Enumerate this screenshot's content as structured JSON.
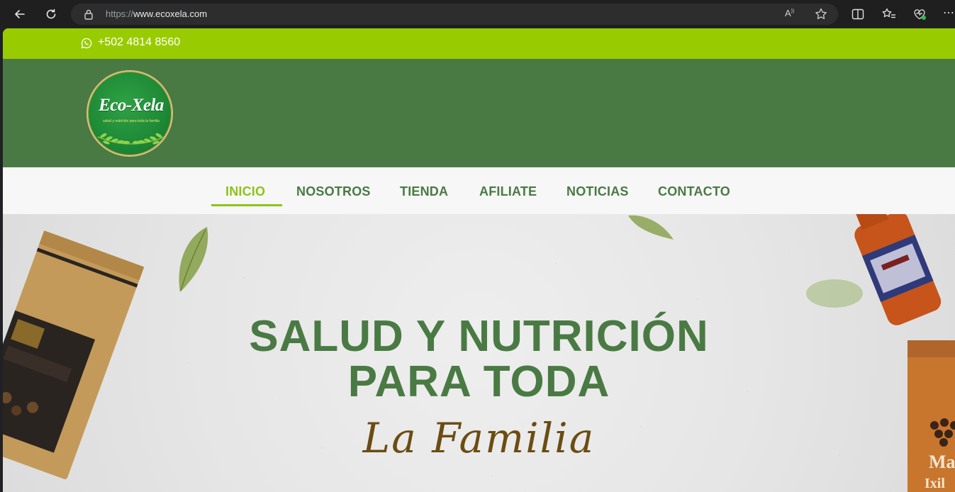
{
  "browser": {
    "url_prefix": "https://",
    "url_host": "www.ecoxela.com",
    "icons": [
      "back-icon",
      "refresh-icon",
      "lock-icon",
      "read-aloud-icon",
      "favorite-star-icon",
      "split-screen-icon",
      "favorites-icon",
      "browser-essentials-icon",
      "more-icon"
    ]
  },
  "topbar": {
    "phone": "+502 4814 8560",
    "icon": "whatsapp-icon"
  },
  "header": {
    "logo_text": "Eco-Xela",
    "logo_tagline": "salud y nutrición para toda la familia"
  },
  "nav": {
    "items": [
      {
        "label": "INICIO",
        "active": true
      },
      {
        "label": "NOSOTROS",
        "active": false
      },
      {
        "label": "TIENDA",
        "active": false
      },
      {
        "label": "AFILIATE",
        "active": false
      },
      {
        "label": "NOTICIAS",
        "active": false
      },
      {
        "label": "CONTACTO",
        "active": false
      }
    ]
  },
  "hero": {
    "line1": "SALUD Y NUTRICIÓN",
    "line2": "PARA TODA",
    "script": "La Familia"
  },
  "colors": {
    "topbar": "#99cc00",
    "header": "#4a7a44",
    "nav_active": "#8cc417",
    "nav_text": "#4a7a44",
    "hero_title": "#4a7a44",
    "hero_script": "#6b4c12"
  }
}
